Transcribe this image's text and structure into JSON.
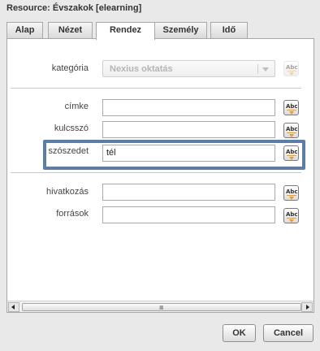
{
  "window": {
    "title": "Resource: Évszakok [elearning]"
  },
  "tabs": [
    {
      "label": "Alap"
    },
    {
      "label": "Nézet"
    },
    {
      "label": "Rendez",
      "active": true
    },
    {
      "label": "Személy"
    },
    {
      "label": "Idő"
    }
  ],
  "form": {
    "kategoria": {
      "label": "kategória",
      "value": "Nexius oktatás",
      "disabled": true
    },
    "cimke": {
      "label": "címke",
      "value": ""
    },
    "kulcsszo": {
      "label": "kulcsszó",
      "value": ""
    },
    "szoszedet": {
      "label": "szószedet",
      "value": "tél",
      "highlighted": true
    },
    "hivatkozas": {
      "label": "hivatkozás",
      "value": ""
    },
    "forrasok": {
      "label": "források",
      "value": ""
    }
  },
  "icons": {
    "abc_button": "abc-spellcheck-icon",
    "select_arrow": "chevron-down-icon",
    "scroll_left": "arrow-left-icon",
    "scroll_right": "arrow-right-icon",
    "scroll_grip": "grip-icon",
    "abc_text": "Abc"
  },
  "scrollbar": {
    "grip": "IIII"
  },
  "colors": {
    "highlight": "#5b7da8",
    "abc_accent": "#f39a1d"
  },
  "buttons": {
    "ok": "OK",
    "cancel": "Cancel"
  }
}
